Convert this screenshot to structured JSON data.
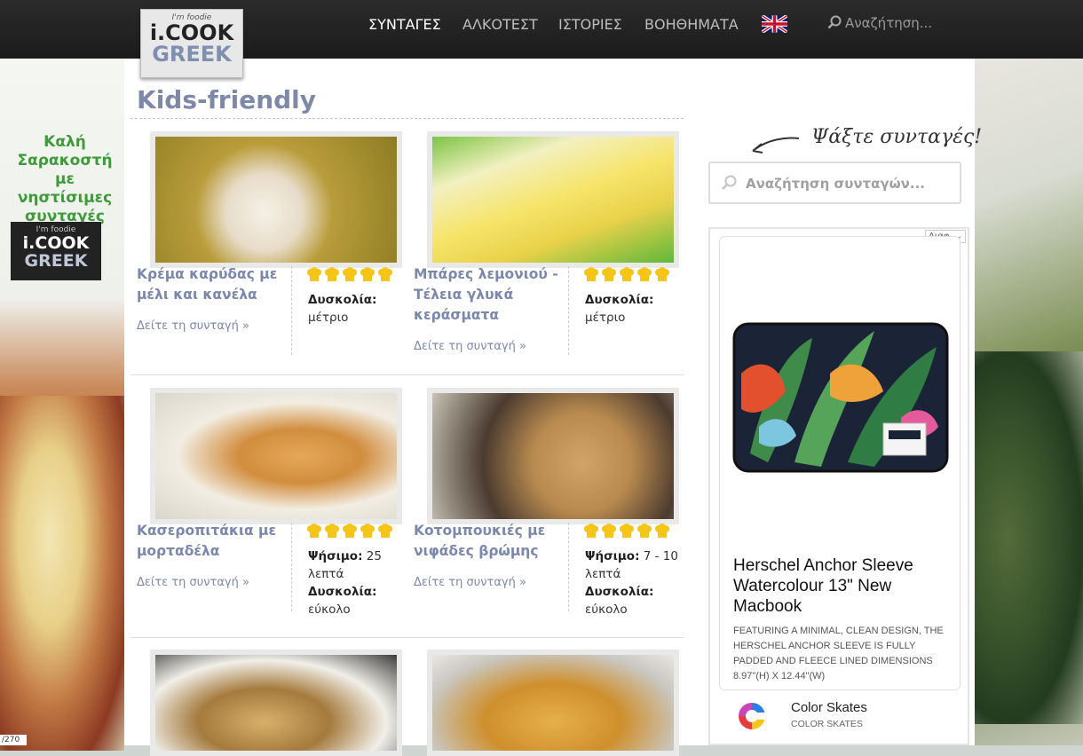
{
  "header": {
    "logo": {
      "tagline": "I'm foodie",
      "line1": "i.COOK",
      "line2": "GREEK"
    },
    "nav": [
      "ΣΥΝΤΑΓΕΣ",
      "ΑΛΚΟΤΕΣΤ",
      "ΙΣΤΟΡΙΕΣ",
      "ΒΟΗΘΗΜΑΤΑ"
    ],
    "active_nav": "ΣΥΝΤΑΓΕΣ",
    "language_flag": "uk-flag-icon",
    "search_placeholder": "Αναζήτηση..."
  },
  "promo_left": {
    "text": "Καλή Σαρακοστή με νηστίσιμες συνταγές",
    "logo_tagline": "I'm foodie",
    "logo_line1": "i.COOK",
    "logo_line2": "GREEK"
  },
  "page": {
    "title": "Kids-friendly"
  },
  "recipes": [
    {
      "title": "Κρέμα καρύδας με μέλι και κανέλα",
      "link": "Δείτε τη συνταγή »",
      "rating": 5,
      "difficulty_label": "Δυσκολία:",
      "difficulty": "μέτριο",
      "bake_label": "",
      "bake": "",
      "image": "coconut-cream-image"
    },
    {
      "title": "Μπάρες λεμονιού - Τέλεια γλυκά κεράσματα",
      "link": "Δείτε τη συνταγή »",
      "rating": 5,
      "difficulty_label": "Δυσκολία:",
      "difficulty": "μέτριο",
      "bake_label": "",
      "bake": "",
      "image": "lemon-bars-image"
    },
    {
      "title": "Κασεροπιτάκια με μορταδέλα",
      "link": "Δείτε τη συνταγή »",
      "rating": 5,
      "bake_label": "Ψήσιμο:",
      "bake": "25 λεπτά",
      "difficulty_label": "Δυσκολία:",
      "difficulty": "εύκολο",
      "image": "cheese-pies-image"
    },
    {
      "title": "Κοτομπουκιές με νιφάδες βρώμης",
      "link": "Δείτε τη συνταγή »",
      "rating": 5,
      "bake_label": "Ψήσιμο:",
      "bake": "7 - 10 λεπτά",
      "difficulty_label": "Δυσκολία:",
      "difficulty": "εύκολο",
      "image": "chicken-nuggets-image"
    },
    {
      "image": "stuffed-potatoes-image"
    },
    {
      "image": "cheese-puffs-image"
    }
  ],
  "sidebar": {
    "heading": "Ψάξτε συνταγές!",
    "search_placeholder": "Αναζήτηση συνταγών..."
  },
  "ad": {
    "choice_label": "Διαφ.",
    "title": "Herschel Anchor Sleeve Watercolour 13\" New Macbook",
    "description": "Featuring a minimal, clean design, the Herschel Anchor Sleeve is fully padded and fleece lined DIMENSIONS 8.97\"(H) X 12.44\"(W)",
    "brand": "Color Skates",
    "brand_sub": "COLOR SKATES"
  },
  "page_counter": "/270",
  "colors": {
    "accent": "#7b88ac",
    "header_bg": "#1f1f1f",
    "promo_green": "#3f9b3a",
    "hat_yellow": "#f5c518"
  }
}
